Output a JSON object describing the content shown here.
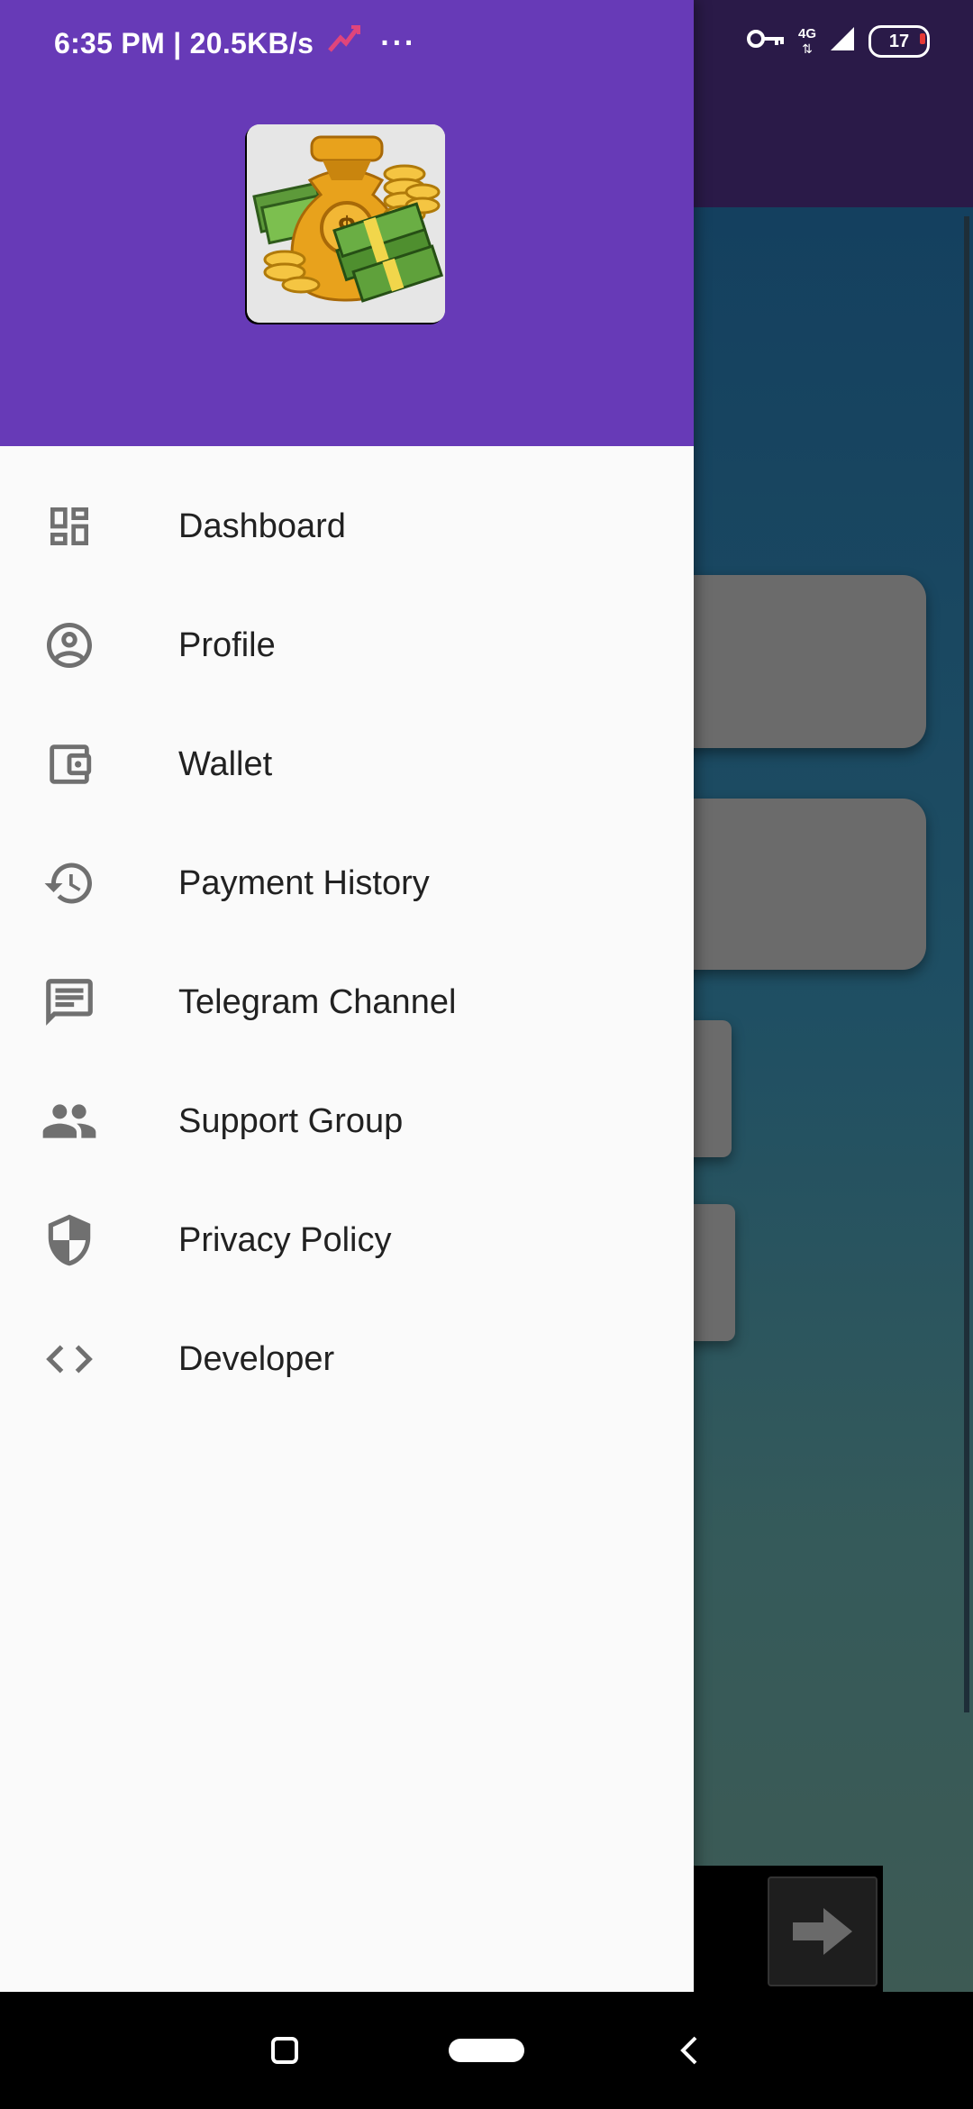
{
  "status_bar": {
    "time_speed": "6:35 PM | 20.5KB/s",
    "more": "···",
    "network": "4G",
    "battery": "17"
  },
  "drawer": {
    "logo_icon": "money-bag-coins-icon",
    "menu_items": [
      {
        "icon": "dashboard-icon",
        "label": "Dashboard"
      },
      {
        "icon": "account-circle-icon",
        "label": "Profile"
      },
      {
        "icon": "wallet-icon",
        "label": "Wallet"
      },
      {
        "icon": "history-icon",
        "label": "Payment History"
      },
      {
        "icon": "chat-icon",
        "label": "Telegram Channel"
      },
      {
        "icon": "people-icon",
        "label": "Support Group"
      },
      {
        "icon": "shield-icon",
        "label": "Privacy Policy"
      },
      {
        "icon": "code-icon",
        "label": "Developer"
      }
    ]
  },
  "colors": {
    "drawer_header": "#673ab7",
    "drawer_background": "#fafafa",
    "icon": "#707070"
  }
}
